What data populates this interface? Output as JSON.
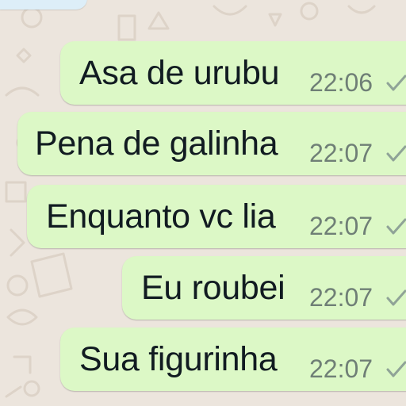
{
  "conversation": {
    "messages": [
      {
        "text": "Asa de urubu",
        "time": "22:06",
        "status": "sent",
        "status_icon": "check-icon"
      },
      {
        "text": "Pena de galinha",
        "time": "22:07",
        "status": "sent",
        "status_icon": "check-icon"
      },
      {
        "text": "Enquanto vc lia",
        "time": "22:07",
        "status": "sent",
        "status_icon": "check-icon"
      },
      {
        "text": "Eu roubei",
        "time": "22:07",
        "status": "sent",
        "status_icon": "check-icon"
      },
      {
        "text": "Sua figurinha",
        "time": "22:07",
        "status": "sent",
        "status_icon": "check-icon"
      }
    ]
  },
  "colors": {
    "wallpaper": "#ece5dd",
    "outgoing_bubble": "#dcf8c6",
    "incoming_bubble": "#ddeef8",
    "message_text": "#111b21",
    "timestamp": "#6f7f76"
  }
}
